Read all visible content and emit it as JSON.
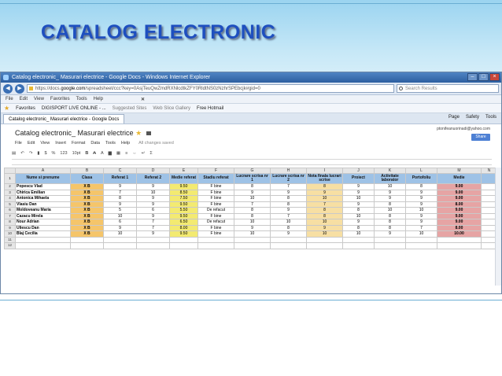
{
  "slide": {
    "title": "CATALOG ELECTRONIC"
  },
  "browser": {
    "window_title": "Catalog electronic_ Masurari electrice - Google Docs - Windows Internet Explorer",
    "url_prefix": "https://docs.",
    "url_domain": "google.com",
    "url_rest": "/spreadsheet/ccc?key=0AsjTeuQwZmdRXNlcdtkZFY0RldtNS0zNzhrSPEbcjk#gid=0",
    "search_placeholder": "Search Results",
    "menu": [
      "File",
      "Edit",
      "View",
      "Favorites",
      "Tools",
      "Help"
    ],
    "favorites_label": "Favorites",
    "favorites_links": [
      "DIGISPORT LIVE ONLINE - ...",
      "Suggested Sites",
      "Web Slice Gallery",
      "Free Hotmail"
    ],
    "tab_label": "Catalog electronic_ Masurari electrice - Google Docs",
    "tab_tools": [
      "Page",
      "Safety",
      "Tools"
    ]
  },
  "doc": {
    "title": "Catalog electronic_ Masurari electrice",
    "user_email": "ptonifeanuorinadi@yahoo.com",
    "share_label": "Share",
    "menu": [
      "File",
      "Edit",
      "View",
      "Insert",
      "Format",
      "Data",
      "Tools",
      "Help"
    ],
    "saved_status": "All changes saved",
    "toolbar_zoom": "%",
    "toolbar_format": "123",
    "toolbar_font_size": "10pt"
  },
  "sheet": {
    "col_letters": [
      "A",
      "B",
      "C",
      "D",
      "E",
      "F",
      "G",
      "H",
      "I",
      "J",
      "K",
      "L",
      "M",
      "N"
    ],
    "header": [
      "Nume si prenume",
      "Clasa",
      "Referat 1",
      "Referat 2",
      "Medie referat",
      "Stadiu referat",
      "Lucrare scrisa nr 1",
      "Lucrare scrisa nr 2",
      "Nota finala lucrari scrise",
      "Proiect",
      "Activitate laborator",
      "Portofoliu",
      "Medie"
    ],
    "rows": [
      [
        "Popescu Vlad",
        "X B",
        "9",
        "9",
        "9.50",
        "F bine",
        "8",
        "7",
        "8",
        "9",
        "10",
        "8",
        "9.00"
      ],
      [
        "Chirica Emilian",
        "X B",
        "7",
        "10",
        "8.50",
        "F bine",
        "9",
        "9",
        "9",
        "9",
        "9",
        "9",
        "9.00"
      ],
      [
        "Antonica Mihaela",
        "X B",
        "8",
        "9",
        "7.50",
        "F bine",
        "10",
        "8",
        "10",
        "10",
        "9",
        "9",
        "9.00"
      ],
      [
        "Vlasiu Dan",
        "X B",
        "9",
        "9",
        "9.50",
        "F bine",
        "7",
        "8",
        "7",
        "9",
        "8",
        "9",
        "8.00"
      ],
      [
        "Moldoveanu Maria",
        "X B",
        "5",
        "6",
        "5.50",
        "De refacut",
        "8",
        "9",
        "8",
        "8",
        "10",
        "10",
        "9.00"
      ],
      [
        "Cazacu Mirela",
        "X B",
        "10",
        "9",
        "9.50",
        "F bine",
        "8",
        "7",
        "8",
        "10",
        "8",
        "9",
        "9.00"
      ],
      [
        "Nour Adrian",
        "X B",
        "6",
        "7",
        "6.50",
        "De refacut",
        "10",
        "10",
        "10",
        "9",
        "8",
        "9",
        "9.00"
      ],
      [
        "Uliescu Dan",
        "X B",
        "9",
        "7",
        "8.00",
        "F bine",
        "9",
        "8",
        "9",
        "8",
        "8",
        "7",
        "8.00"
      ],
      [
        "Blaj Cecilia",
        "X B",
        "10",
        "9",
        "9.50",
        "F bine",
        "10",
        "9",
        "10",
        "10",
        "9",
        "10",
        "10.00"
      ]
    ]
  },
  "colors": {
    "title": "#1e4fbf",
    "header_fill": "#9ec2e6",
    "clasa_fill": "#f5c56a",
    "medie_referat_fill": "#f3ea71",
    "medie_fill": "#e6a4a4"
  }
}
